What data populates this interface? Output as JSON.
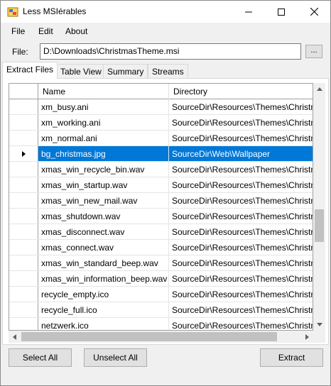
{
  "window": {
    "title": "Less MSIérables"
  },
  "menu": {
    "file": "File",
    "edit": "Edit",
    "about": "About"
  },
  "file_row": {
    "label": "File:",
    "path": "D:\\Downloads\\ChristmasTheme.msi",
    "browse": "..."
  },
  "tabs": [
    {
      "label": "Extract Files",
      "active": true
    },
    {
      "label": "Table View",
      "active": false
    },
    {
      "label": "Summary",
      "active": false
    },
    {
      "label": "Streams",
      "active": false
    }
  ],
  "grid": {
    "headers": {
      "name": "Name",
      "directory": "Directory"
    },
    "rows": [
      {
        "name": "xm_busy.ani",
        "directory": "SourceDir\\Resources\\Themes\\Christmas",
        "selected": false
      },
      {
        "name": "xm_working.ani",
        "directory": "SourceDir\\Resources\\Themes\\Christmas",
        "selected": false
      },
      {
        "name": "xm_normal.ani",
        "directory": "SourceDir\\Resources\\Themes\\Christmas",
        "selected": false
      },
      {
        "name": "bg_christmas.jpg",
        "directory": "SourceDir\\Web\\Wallpaper",
        "selected": true
      },
      {
        "name": "xmas_win_recycle_bin.wav",
        "directory": "SourceDir\\Resources\\Themes\\Christmas",
        "selected": false
      },
      {
        "name": "xmas_win_startup.wav",
        "directory": "SourceDir\\Resources\\Themes\\Christmas",
        "selected": false
      },
      {
        "name": "xmas_win_new_mail.wav",
        "directory": "SourceDir\\Resources\\Themes\\Christmas",
        "selected": false
      },
      {
        "name": "xmas_shutdown.wav",
        "directory": "SourceDir\\Resources\\Themes\\Christmas",
        "selected": false
      },
      {
        "name": "xmas_disconnect.wav",
        "directory": "SourceDir\\Resources\\Themes\\Christmas",
        "selected": false
      },
      {
        "name": "xmas_connect.wav",
        "directory": "SourceDir\\Resources\\Themes\\Christmas",
        "selected": false
      },
      {
        "name": "xmas_win_standard_beep.wav",
        "directory": "SourceDir\\Resources\\Themes\\Christmas",
        "selected": false
      },
      {
        "name": "xmas_win_information_beep.wav",
        "directory": "SourceDir\\Resources\\Themes\\Christmas",
        "selected": false
      },
      {
        "name": "recycle_empty.ico",
        "directory": "SourceDir\\Resources\\Themes\\Christmas",
        "selected": false
      },
      {
        "name": "recycle_full.ico",
        "directory": "SourceDir\\Resources\\Themes\\Christmas",
        "selected": false
      },
      {
        "name": "netzwerk.ico",
        "directory": "SourceDir\\Resources\\Themes\\Christmas",
        "selected": false
      }
    ]
  },
  "buttons": {
    "select_all": "Select All",
    "unselect_all": "Unselect All",
    "extract": "Extract"
  },
  "colors": {
    "selection": "#0078d7",
    "window_bg": "#f0f0f0"
  },
  "icons": [
    "app-icon",
    "minimize-icon",
    "maximize-icon",
    "close-icon",
    "row-pointer-icon",
    "arrow-up-icon",
    "arrow-down-icon",
    "arrow-left-icon",
    "arrow-right-icon"
  ]
}
